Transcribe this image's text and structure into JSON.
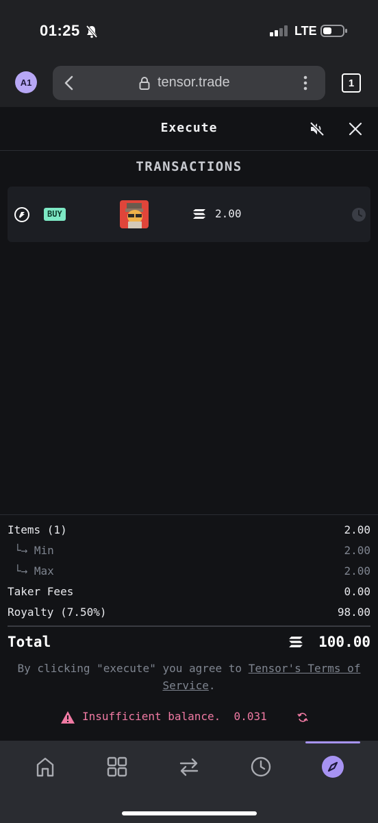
{
  "status_bar": {
    "time": "01:25",
    "network": "LTE"
  },
  "browser": {
    "profile": "A1",
    "url": "tensor.trade",
    "tab_count": "1"
  },
  "header": {
    "title": "Execute"
  },
  "transactions": {
    "title": "TRANSACTIONS",
    "rows": [
      {
        "type": "BUY",
        "price": "2.00"
      }
    ]
  },
  "summary": {
    "items_label": "Items (1)",
    "items_value": "2.00",
    "min_label": "└→ Min",
    "min_value": "2.00",
    "max_label": "└→ Max",
    "max_value": "2.00",
    "fees_label": "Taker Fees",
    "fees_value": "0.00",
    "royalty_label": "Royalty (7.50%)",
    "royalty_value": "98.00",
    "total_label": "Total",
    "total_value": "100.00"
  },
  "terms": {
    "prefix": "By clicking \"execute\" you agree to ",
    "link": "Tensor's Terms of Service",
    "suffix": "."
  },
  "warning": {
    "text": "Insufficient balance.  0.031"
  },
  "colors": {
    "accent": "#a793f2",
    "buy_badge": "#7de8c4",
    "warning": "#f07aa3",
    "background": "#121316"
  },
  "nav": [
    "home-icon",
    "grid-icon",
    "swap-icon",
    "clock-icon",
    "compass-icon"
  ]
}
